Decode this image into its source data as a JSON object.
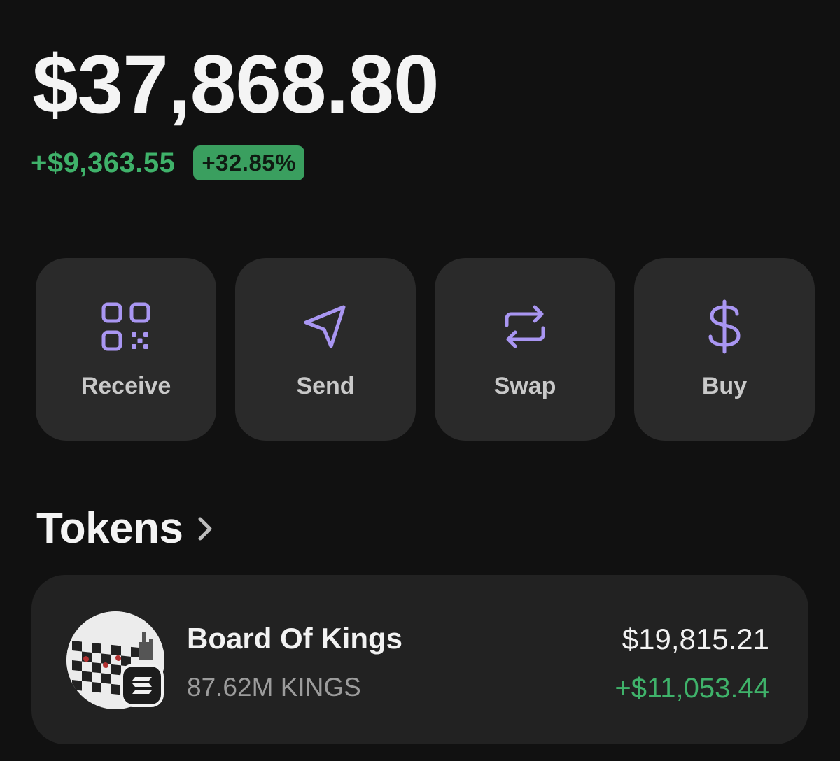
{
  "wallet": {
    "balance": "$37,868.80",
    "change_amount": "+$9,363.55",
    "change_percent": "+32.85%"
  },
  "actions": [
    {
      "label": "Receive",
      "icon": "qr-code-icon"
    },
    {
      "label": "Send",
      "icon": "send-icon"
    },
    {
      "label": "Swap",
      "icon": "swap-icon"
    },
    {
      "label": "Buy",
      "icon": "dollar-icon"
    }
  ],
  "tokens_section": {
    "title": "Tokens",
    "items": [
      {
        "name": "Board Of Kings",
        "amount": "87.62M KINGS",
        "value": "$19,815.21",
        "change": "+$11,053.44",
        "chain_icon": "solana-icon",
        "avatar_icon": "chessboard-token-icon"
      }
    ]
  },
  "colors": {
    "background": "#111111",
    "card": "#2a2a2a",
    "accent": "#a996f2",
    "positive": "#3fb26a"
  }
}
